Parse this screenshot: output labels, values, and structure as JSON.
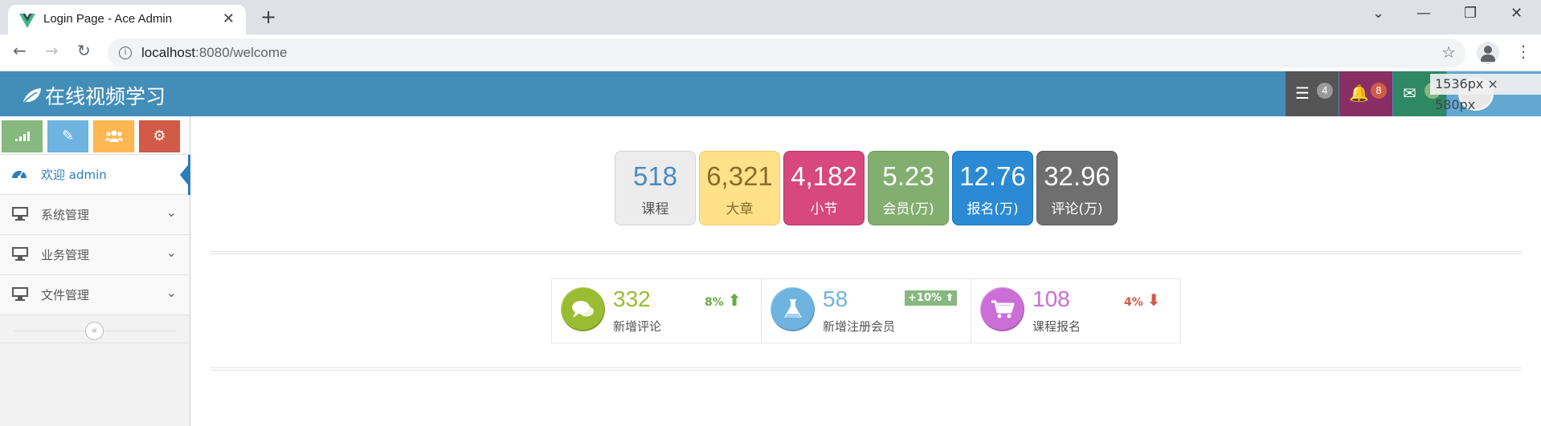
{
  "browser": {
    "tab_title": "Login Page - Ace Admin",
    "tab_close": "✕",
    "new_tab": "+",
    "url_host": "localhost",
    "url_rest": ":8080/welcome",
    "window_controls": {
      "dropdown": "⌄",
      "minimize": "—",
      "restore": "❐",
      "close": "✕"
    }
  },
  "navbar": {
    "brand": "在线视频学习",
    "items": [
      {
        "icon": "tasks-icon",
        "glyph": "☰",
        "badge": "4",
        "bg": "#555555",
        "badge_bg": "#999999"
      },
      {
        "icon": "bell-icon",
        "glyph": "🔔",
        "badge": "8",
        "bg": "#892e65",
        "badge_bg": "#d15b47"
      },
      {
        "icon": "envelope-icon",
        "glyph": "✉",
        "badge": "5",
        "bg": "#2e8965",
        "badge_bg": "#87b87f"
      }
    ],
    "size_tooltip": "1536px × 580px"
  },
  "sidebar": {
    "shortcuts": [
      {
        "name": "signal-icon",
        "glyph": "▁▂▃",
        "bg": "#87b87f"
      },
      {
        "name": "pencil-icon",
        "glyph": "✎",
        "bg": "#6fb3e0"
      },
      {
        "name": "users-icon",
        "glyph": "👥",
        "bg": "#ffb752"
      },
      {
        "name": "cogs-icon",
        "glyph": "⚙",
        "bg": "#d15b47"
      }
    ],
    "items": [
      {
        "label": "欢迎 admin",
        "icon": "dashboard-icon",
        "glyph": "◔",
        "active": true
      },
      {
        "label": "系统管理",
        "icon": "desktop-icon",
        "glyph": "▭",
        "chevron": "⌄"
      },
      {
        "label": "业务管理",
        "icon": "desktop-icon",
        "glyph": "▭",
        "chevron": "⌄"
      },
      {
        "label": "文件管理",
        "icon": "desktop-icon",
        "glyph": "▭",
        "chevron": "⌄"
      }
    ],
    "collapse_glyph": "«"
  },
  "stats": [
    {
      "value": "518",
      "label": "课程",
      "bg": "#ececec",
      "border": "#d4d4d4",
      "value_color": "#4a8bc2",
      "label_color": "#555555"
    },
    {
      "value": "6,321",
      "label": "大章",
      "bg": "#fee188",
      "border": "#eccb71",
      "value_color": "#8b6a2a",
      "label_color": "#8b6a2a"
    },
    {
      "value": "4,182",
      "label": "小节",
      "bg": "#d6487e",
      "border": "#b8346a",
      "value_color": "#ffffff",
      "label_color": "#ffffff"
    },
    {
      "value": "5.23",
      "label": "会员(万)",
      "bg": "#82af6f",
      "border": "#6d9a5b",
      "value_color": "#ffffff",
      "label_color": "#ffffff"
    },
    {
      "value": "12.76",
      "label": "报名(万)",
      "bg": "#2b8ad3",
      "border": "#1f74b8",
      "value_color": "#ffffff",
      "label_color": "#ffffff"
    },
    {
      "value": "32.96",
      "label": "评论(万)",
      "bg": "#6f6f6f",
      "border": "#5a5a5a",
      "value_color": "#ffffff",
      "label_color": "#ffffff"
    }
  ],
  "infoboxes": [
    {
      "icon": "comments-icon",
      "glyph": "💬",
      "icon_bg": "#9abc32",
      "value": "332",
      "value_color": "#9abc32",
      "label": "新增评论",
      "stat": "8%",
      "stat_color": "#69aa46",
      "arrow": "⬆",
      "kind": "stat"
    },
    {
      "icon": "flask-icon",
      "glyph": "⚗",
      "icon_bg": "#6fb3e0",
      "value": "58",
      "value_color": "#6fb3e0",
      "label": "新增注册会员",
      "stat": "+10%",
      "stat_color": "#87b87f",
      "arrow": "⬆",
      "kind": "badge"
    },
    {
      "icon": "shopping-cart-icon",
      "glyph": "🛒",
      "icon_bg": "#cb6fd7",
      "value": "108",
      "value_color": "#cb6fd7",
      "label": "课程报名",
      "stat": "4%",
      "stat_color": "#d15b47",
      "arrow": "⬇",
      "kind": "stat"
    }
  ]
}
